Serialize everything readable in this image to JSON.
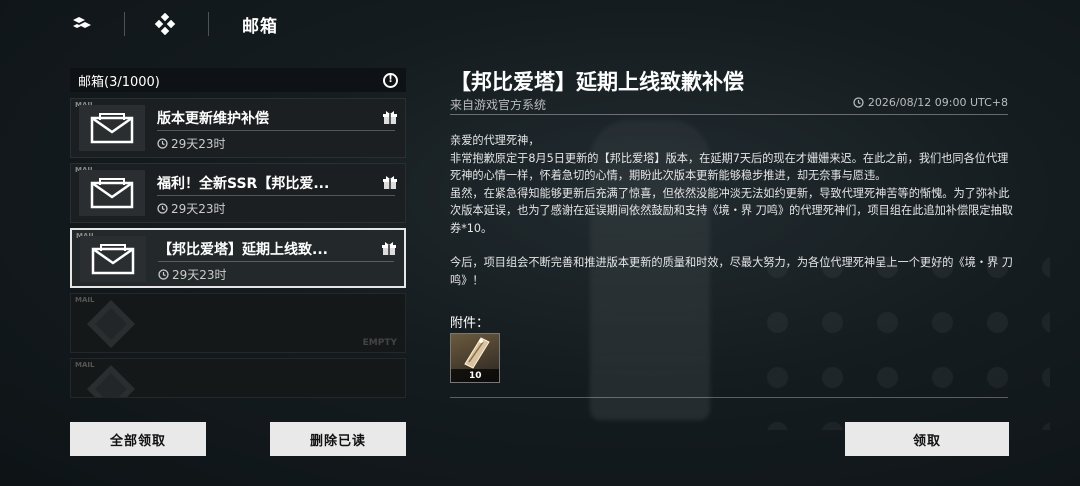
{
  "topbar": {
    "title": "邮箱",
    "icons": [
      "shuffle-icon",
      "diamond-menu-icon"
    ]
  },
  "mailbox": {
    "header": "邮箱(3/1000)",
    "items": [
      {
        "title": "版本更新维护补偿",
        "time": "29天23时",
        "tag": "MAIL"
      },
      {
        "title": "福利！全新SSR【邦比爱...",
        "time": "29天23时",
        "tag": "MAIL"
      },
      {
        "title": "【邦比爱塔】延期上线致...",
        "time": "29天23时",
        "tag": "MAIL"
      }
    ],
    "empty_label": "EMPTY",
    "empty_tag": "MAIL"
  },
  "buttons": {
    "claim_all": "全部领取",
    "delete_read": "删除已读",
    "claim": "领取"
  },
  "detail": {
    "title": "【邦比爱塔】延期上线致歉补偿",
    "sender": "来自游戏官方系统",
    "date": "2026/08/12 09:00 UTC+8",
    "paragraphs": [
      "亲爱的代理死神，",
      "非常抱歉原定于8月5日更新的【邦比爱塔】版本，在延期7天后的现在才姗姗来迟。在此之前，我们也同各位代理死神的心情一样，怀着急切的心情，期盼此次版本更新能够稳步推进，却无奈事与愿违。",
      "虽然，在紧急得知能够更新后充满了惊喜，但依然没能冲淡无法如约更新，导致代理死神苦等的惭愧。为了弥补此次版本延误，也为了感谢在延误期间依然鼓励和支持《境・界 刀鸣》的代理死神们，项目组在此追加补偿限定抽取券*10。",
      "",
      "今后，项目组会不断完善和推进版本更新的质量和时效，尽最大努力，为各位代理死神呈上一个更好的《境・界 刀鸣》！"
    ],
    "attachments_label": "附件：",
    "attachment": {
      "count": "10",
      "icon": "ticket-icon"
    }
  },
  "colors": {
    "button_bg": "#e9e9e9",
    "panel_bg": "#1b1f21",
    "selected_border": "#e6e6e6"
  }
}
